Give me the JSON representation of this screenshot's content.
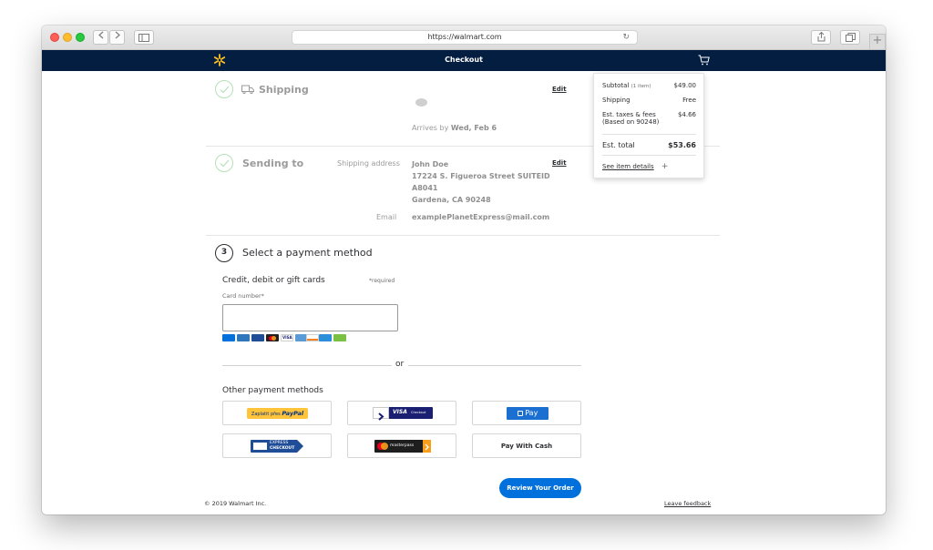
{
  "browser": {
    "url": "https://walmart.com"
  },
  "header": {
    "title": "Checkout"
  },
  "shipping_step": {
    "title": "Shipping",
    "edit_label": "Edit",
    "arrives_prefix": "Arrives by ",
    "arrives_date": "Wed, Feb 6"
  },
  "sending_step": {
    "title": "Sending to",
    "address_label": "Shipping address",
    "name": "John Doe",
    "street_line1": "17224 S. Figueroa Street SUITEID",
    "street_line2": "A8041",
    "city_line": "Gardena, CA 90248",
    "email_label": "Email",
    "email": "examplePlanetExpress@mail.com",
    "edit_label": "Edit"
  },
  "payment_step": {
    "number": "3",
    "title": "Select a payment method",
    "cards_heading": "Credit, debit or gift cards",
    "required_note": "*required",
    "card_number_label": "Card number*",
    "card_number_value": "",
    "card_logos": [
      "walmart-card",
      "amex-card",
      "amex-blue-card",
      "mastercard-card",
      "visa-card",
      "amex-gold-card",
      "discover-card",
      "walmart-credit-card",
      "gift-card"
    ],
    "or_label": "or",
    "other_heading": "Other payment methods",
    "methods": {
      "paypal": {
        "prefix": "Zaplatit přes ",
        "brand": "PayPal"
      },
      "visa_checkout": {
        "brand": "VISA",
        "suffix": "Checkout"
      },
      "chase_pay": {
        "brand": "Pay"
      },
      "amex_express": {
        "line1": "EXPRESS",
        "line2": "CHECKOUT"
      },
      "masterpass": {
        "brand": "masterpass"
      },
      "cash": {
        "label": "Pay With Cash"
      }
    },
    "review_button": "Review Your Order"
  },
  "summary": {
    "subtotal_label": "Subtotal",
    "subtotal_count": "(1 item)",
    "subtotal_value": "$49.00",
    "shipping_label": "Shipping",
    "shipping_value": "Free",
    "taxes_label": "Est. taxes & fees",
    "taxes_sub": "(Based on 90248)",
    "taxes_value": "$4.66",
    "total_label": "Est. total",
    "total_value": "$53.66",
    "details_link": "See item details",
    "details_icon": "+"
  },
  "footer": {
    "copyright": "© 2019 Walmart Inc.",
    "feedback": "Leave feedback"
  },
  "colors": {
    "header_bg": "#041e42",
    "spark": "#ffc220",
    "primary_button": "#0071dc",
    "success": "#b4e0b8"
  }
}
